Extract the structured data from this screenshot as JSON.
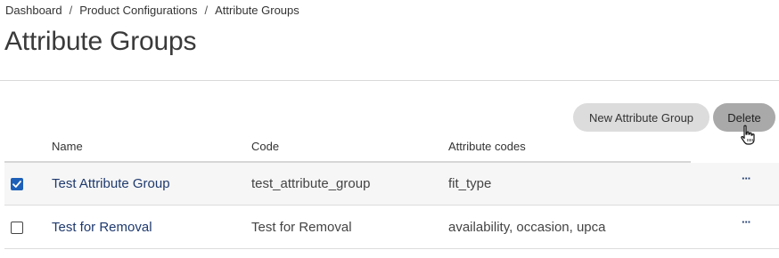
{
  "breadcrumb": {
    "items": [
      "Dashboard",
      "Product Configurations",
      "Attribute Groups"
    ],
    "separator": "/"
  },
  "page": {
    "title": "Attribute Groups"
  },
  "toolbar": {
    "new_label": "New Attribute Group",
    "delete_label": "Delete"
  },
  "table": {
    "columns": [
      "Name",
      "Code",
      "Attribute codes"
    ],
    "rows": [
      {
        "checked": true,
        "name": "Test Attribute Group",
        "code": "test_attribute_group",
        "attributes": "fit_type",
        "actions": "···"
      },
      {
        "checked": false,
        "name": "Test for Removal",
        "code": "Test for Removal",
        "attributes": "availability, occasion, upca",
        "actions": "···"
      }
    ]
  },
  "colors": {
    "link": "#1f3a6e",
    "checkbox": "#1c5fb8",
    "delete_button": "#a9a9a9",
    "new_button": "#dcdcdc"
  },
  "icons": {
    "checkbox_checked": "checkmark-icon",
    "row_actions": "more-horizontal-icon",
    "cursor": "hand-pointer-icon"
  }
}
